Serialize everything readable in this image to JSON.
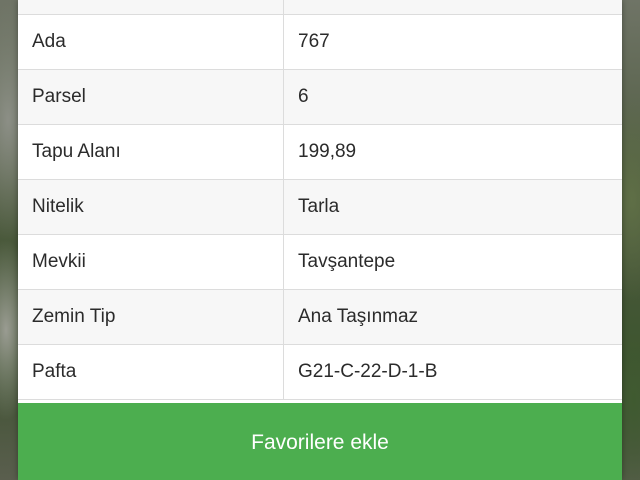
{
  "parcel_info": {
    "rows": [
      {
        "label": "",
        "value": ""
      },
      {
        "label": "Ada",
        "value": "767"
      },
      {
        "label": "Parsel",
        "value": "6"
      },
      {
        "label": "Tapu Alanı",
        "value": "199,89"
      },
      {
        "label": "Nitelik",
        "value": "Tarla"
      },
      {
        "label": "Mevkii",
        "value": "Tavşantepe"
      },
      {
        "label": "Zemin Tip",
        "value": "Ana Taşınmaz"
      },
      {
        "label": "Pafta",
        "value": "G21-C-22-D-1-B"
      }
    ]
  },
  "actions": {
    "favorite_label": "Favorilere ekle"
  },
  "colors": {
    "button_green": "#4cae4f",
    "panel_bg": "#ffffff",
    "row_alt_bg": "#f7f7f7",
    "border": "#dcdcdc"
  }
}
